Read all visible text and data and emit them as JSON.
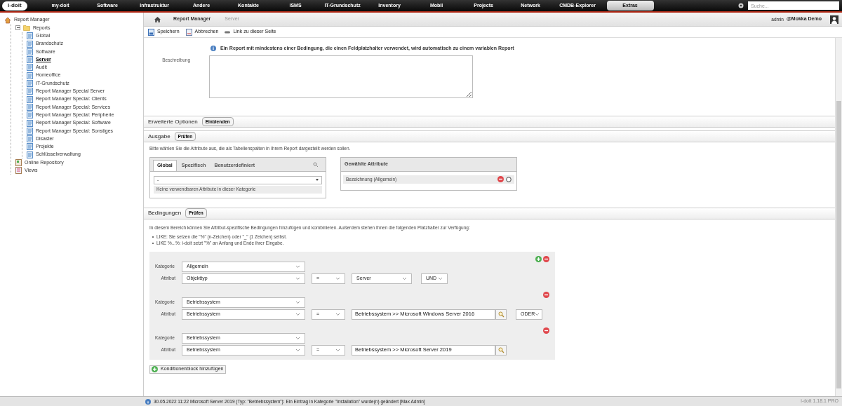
{
  "topbar": {
    "logo": "i-doit",
    "menu": [
      {
        "label": "my-doit",
        "selected": false
      },
      {
        "label": "Software",
        "selected": false
      },
      {
        "label": "Infrastruktur",
        "selected": false
      },
      {
        "label": "Andere",
        "selected": false
      },
      {
        "label": "Kontakte",
        "selected": false
      },
      {
        "label": "ISMS",
        "selected": false
      },
      {
        "label": "IT-Grundschutz",
        "selected": false
      },
      {
        "label": "Inventory",
        "selected": false
      },
      {
        "label": "Mobil",
        "selected": false
      },
      {
        "label": "Projects",
        "selected": false
      },
      {
        "label": "Network",
        "selected": false
      },
      {
        "label": "CMDB-Explorer",
        "selected": false
      },
      {
        "label": "Extras",
        "selected": true
      }
    ],
    "search": {
      "placeholder": "Suche..."
    }
  },
  "sidebar": {
    "tree": [
      {
        "label": "Report Manager",
        "kind": "home",
        "children": [
          {
            "label": "Reports",
            "kind": "folder",
            "expanded": true,
            "children": [
              {
                "label": "Global",
                "kind": "report",
                "selected": false
              },
              {
                "label": "Brandschutz",
                "kind": "report",
                "selected": false
              },
              {
                "label": "Software",
                "kind": "report",
                "selected": false
              },
              {
                "label": "Server",
                "kind": "report",
                "selected": true
              },
              {
                "label": "Audit",
                "kind": "report",
                "selected": false
              },
              {
                "label": "Homeoffice",
                "kind": "report",
                "selected": false
              },
              {
                "label": "IT-Grundschutz",
                "kind": "report",
                "selected": false
              },
              {
                "label": "Report Manager Special Server",
                "kind": "report",
                "selected": false
              },
              {
                "label": "Report Manager Special: Clients",
                "kind": "report",
                "selected": false
              },
              {
                "label": "Report Manager Special: Services",
                "kind": "report",
                "selected": false
              },
              {
                "label": "Report Manager Special: Peripherie",
                "kind": "report",
                "selected": false
              },
              {
                "label": "Report Manager Special: Software",
                "kind": "report",
                "selected": false
              },
              {
                "label": "Report Manager Special: Sonstiges",
                "kind": "report",
                "selected": false
              },
              {
                "label": "Disaster",
                "kind": "report",
                "selected": false
              },
              {
                "label": "Projekte",
                "kind": "report",
                "selected": false
              },
              {
                "label": "Schlüsselverwaltung",
                "kind": "report",
                "selected": false
              }
            ]
          },
          {
            "label": "Online Repository",
            "kind": "repository"
          },
          {
            "label": "Views",
            "kind": "views"
          }
        ]
      }
    ]
  },
  "breadcrumb": [
    "Report Manager",
    "Server"
  ],
  "user": {
    "name": "admin",
    "tenant": "@Mokka Demo"
  },
  "toolbar": [
    {
      "label": "Speichern",
      "kind": "save"
    },
    {
      "label": "Abbrechen",
      "kind": "cancel"
    },
    {
      "label": "Link zu dieser Seite",
      "kind": "link"
    }
  ],
  "info_note": "Ein Report mit mindestens einer Bedingung, die einen Feldplatzhalter verwendet, wird automatisch zu einem variablen Report",
  "description_label": "Beschreibung",
  "advanced": {
    "title": "Erweiterte Optionen",
    "button": "Einblenden"
  },
  "output": {
    "title": "Ausgabe",
    "button": "Prüfen",
    "hint": "Bitte wählen Sie die Attribute aus, die als Tabellenspalten in Ihrem Report dargestellt werden sollen.",
    "tabs": [
      {
        "label": "Global",
        "selected": true
      },
      {
        "label": "Spezifisch",
        "selected": false
      },
      {
        "label": "Benutzerdefiniert",
        "selected": false
      }
    ],
    "category_select": "-",
    "empty_note": "Keine verwendbaren Attribute in dieser Kategorie",
    "selected_title": "Gewählte Attribute",
    "selected_attributes": [
      "Bezeichnung (Allgemein)"
    ]
  },
  "conditions": {
    "title": "Bedingungen",
    "button": "Prüfen",
    "intro": "In diesem Bereich können Sie Attribut-spezifische Bedingungen hinzufügen und kombinieren. Außerdem stehen Ihnen die folgenden Platzhalter zur Verfügung:",
    "bullets": [
      "LIKE: Sie setzen die \"%\" (n-Zeichen) oder \"_\" (1 Zeichen) selbst.",
      "LIKE %...%: i-doit setzt \"%\" an Anfang und Ende ihrer Eingabe."
    ],
    "blocks": [
      {
        "actions": [
          {
            "kind": "add"
          },
          {
            "kind": "remove"
          }
        ],
        "category_label": "Kategorie",
        "category": "Allgemein",
        "attribute_label": "Attribut",
        "attribute": "Objekttyp",
        "operator": "=",
        "kind": "select",
        "value": "Server",
        "connector": "UND"
      },
      {
        "actions": [
          {
            "kind": "remove"
          }
        ],
        "category_label": "Kategorie",
        "category": "Betriebssystem",
        "attribute_label": "Attribut",
        "attribute": "Betriebssystem",
        "operator": "=",
        "kind": "lookup",
        "value": "Betriebssystem >> Microsoft Windows Server 2016",
        "connector": "ODER"
      },
      {
        "actions": [
          {
            "kind": "remove"
          }
        ],
        "category_label": "Kategorie",
        "category": "Betriebssystem",
        "attribute_label": "Attribut",
        "attribute": "Betriebssystem",
        "operator": "=",
        "kind": "lookup",
        "value": "Betriebssystem >> Microsoft Server 2019"
      }
    ],
    "add_block": "Konditionenblock hinzufügen"
  },
  "status_bar": {
    "message": "30.05.2022 11:22 Microsoft Server 2019 (Typ: \"Betriebssystem\"): Ein Eintrag in Kategorie \"Installation\" wurde(n) geändert [Max Admin]",
    "version": "i-doit 1.18.1 PRO"
  }
}
